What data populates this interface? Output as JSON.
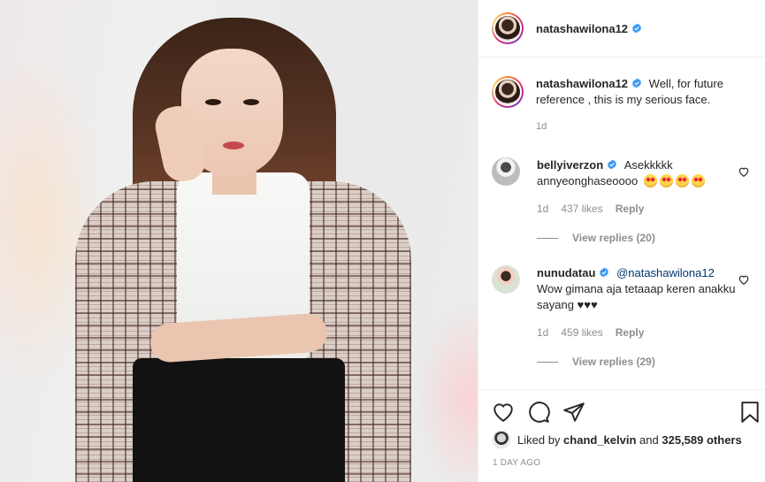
{
  "post": {
    "username": "natashawilona12",
    "caption": "Well, for future reference , this is my serious face.",
    "caption_time": "1d"
  },
  "comments": [
    {
      "username": "bellyiverzon",
      "text": "Asekkkkk annyeonghaseoooo",
      "emoji": [
        "star-struck",
        "star-struck",
        "star-struck",
        "star-struck"
      ],
      "time": "1d",
      "likes": "437 likes",
      "reply": "Reply",
      "view_replies": "View replies (20)"
    },
    {
      "username": "nunudatau",
      "mention": "@natashawilona12",
      "text": "Wow gimana aja tetaaap keren anakku sayang ♥♥♥",
      "time": "1d",
      "likes": "459 likes",
      "reply": "Reply",
      "view_replies": "View replies (29)"
    }
  ],
  "actions": {
    "liked_by_prefix": "Liked by",
    "liked_by_user": "chand_kelvin",
    "liked_by_and": "and",
    "liked_by_count": "325,589 others",
    "posted": "1 DAY AGO"
  },
  "icons": [
    "verified-badge-icon",
    "heart-icon",
    "comment-icon",
    "share-icon",
    "save-icon"
  ],
  "colors": {
    "verified": "#3897f0",
    "text": "#262626",
    "muted": "#8e8e8e",
    "mention": "#00376b"
  }
}
